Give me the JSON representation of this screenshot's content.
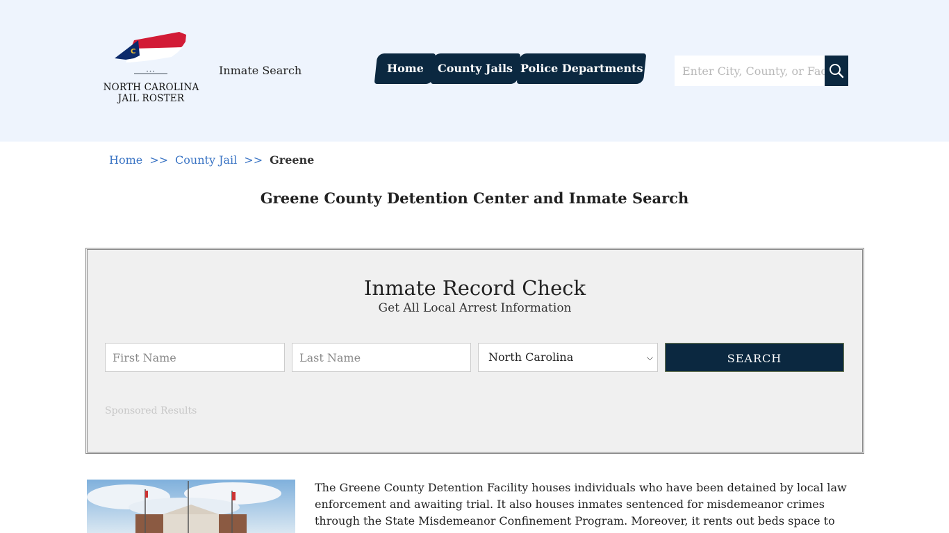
{
  "header": {
    "logo": {
      "line1": "NORTH CAROLINA",
      "line2": "JAIL ROSTER",
      "dots": "•••",
      "flag_colors": {
        "red": "#d21b36",
        "blue": "#0b2a6b",
        "gold": "#f2c230"
      },
      "flag_letter": "C"
    },
    "inmate_search_label": "Inmate Search",
    "nav": [
      {
        "label": "Home"
      },
      {
        "label": "County Jails"
      },
      {
        "label": "Police Departments"
      }
    ],
    "search": {
      "placeholder": "Enter City, County, or Facility",
      "icon": "search-icon"
    }
  },
  "breadcrumb": {
    "items": [
      {
        "label": "Home"
      },
      {
        "label": "County Jail"
      }
    ],
    "separator": ">>",
    "current": "Greene"
  },
  "page_title": "Greene County Detention Center and Inmate Search",
  "record_check": {
    "title": "Inmate Record Check",
    "subtitle": "Get All Local Arrest Information",
    "first_name_placeholder": "First Name",
    "last_name_placeholder": "Last Name",
    "state_selected": "North Carolina",
    "submit_label": "SEARCH",
    "sponsored_label": "Sponsored Results"
  },
  "content": {
    "paragraph": "The Greene County Detention Facility houses individuals who have been detained by local law enforcement and awaiting trial. It also houses inmates sentenced for misdemeanor crimes through the State Misdemeanor Confinement Program. Moreover, it rents out beds space to neighboring counties."
  },
  "colors": {
    "header_bg": "#eef4fd",
    "navy": "#0b2840",
    "link_blue": "#3a74c4",
    "panel_bg": "#f0f0f0"
  }
}
